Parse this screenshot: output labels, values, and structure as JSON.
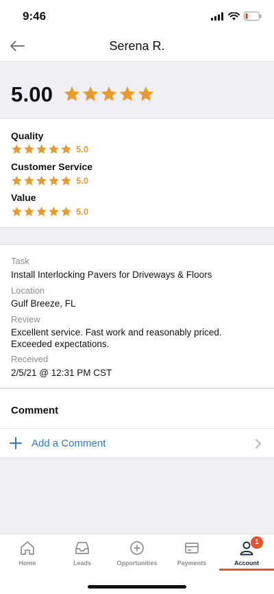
{
  "status_bar": {
    "time": "9:46"
  },
  "header": {
    "title": "Serena R."
  },
  "overall": {
    "score": "5.00",
    "stars": 5
  },
  "ratings": [
    {
      "label": "Quality",
      "value": "5.0",
      "stars": 5
    },
    {
      "label": "Customer Service",
      "value": "5.0",
      "stars": 5
    },
    {
      "label": "Value",
      "value": "5.0",
      "stars": 5
    }
  ],
  "details": {
    "task_label": "Task",
    "task_value": "Install Interlocking Pavers for Driveways & Floors",
    "location_label": "Location",
    "location_value": "Gulf Breeze, FL",
    "review_label": "Review",
    "review_value": "Excellent service. Fast work and reasonably priced. Exceeded expectations.",
    "received_label": "Received",
    "received_value": "2/5/21 @ 12:31 PM CST"
  },
  "comments": {
    "title": "Comment",
    "add_label": "Add a Comment"
  },
  "tabs": [
    {
      "label": "Home",
      "icon": "home-icon"
    },
    {
      "label": "Leads",
      "icon": "inbox-icon"
    },
    {
      "label": "Opportunities",
      "icon": "plus-circle-icon"
    },
    {
      "label": "Payments",
      "icon": "card-icon"
    },
    {
      "label": "Account",
      "icon": "person-icon",
      "badge": "1",
      "active": true
    }
  ],
  "colors": {
    "star": "#e89a2a",
    "link": "#2a78d4",
    "accent": "#e8522a"
  }
}
